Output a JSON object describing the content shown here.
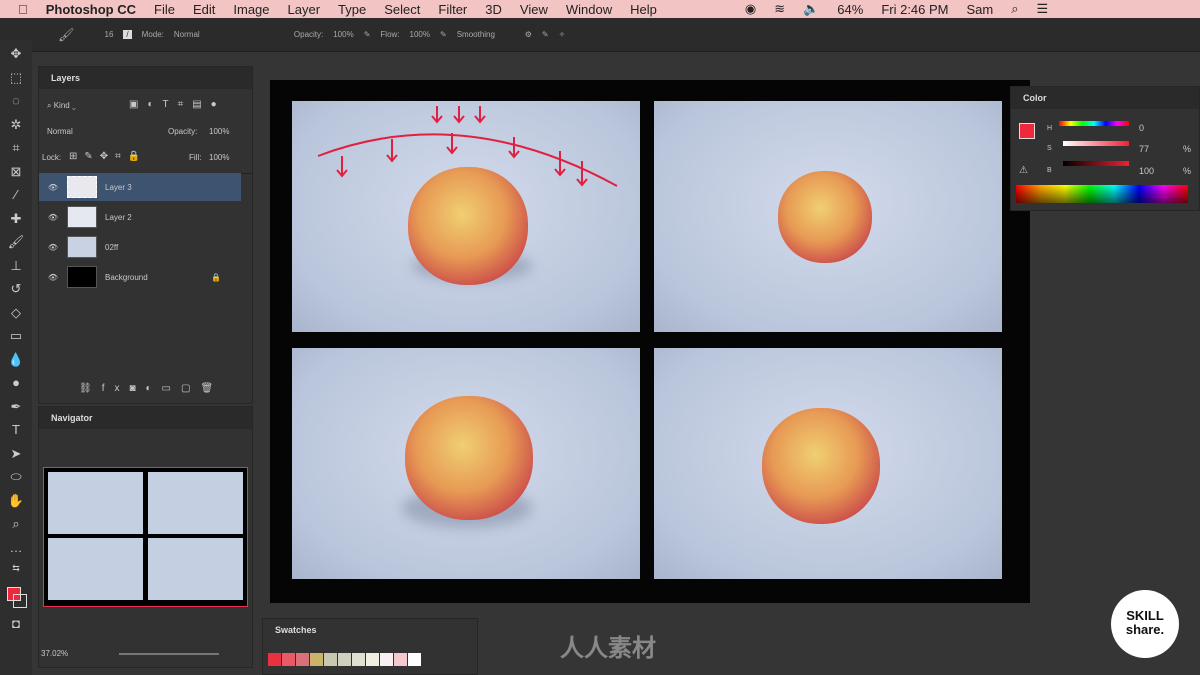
{
  "menubar": {
    "app": "Photoshop CC",
    "items": [
      "File",
      "Edit",
      "Image",
      "Layer",
      "Type",
      "Select",
      "Filter",
      "3D",
      "View",
      "Window",
      "Help"
    ],
    "battery": "64%",
    "clock": "Fri 2:46 PM",
    "user": "Sam"
  },
  "options": {
    "brush_size": "16",
    "mode_label": "Mode:",
    "mode": "Normal",
    "opacity_label": "Opacity:",
    "opacity": "100%",
    "flow_label": "Flow:",
    "flow": "100%",
    "smoothing_label": "Smoothing"
  },
  "layers": {
    "title": "Layers",
    "filter": "Kind",
    "blend": "Normal",
    "opacity_label": "Opacity:",
    "opacity": "100%",
    "lock_label": "Lock:",
    "fill_label": "Fill:",
    "fill": "100%",
    "items": [
      {
        "name": "Layer 3"
      },
      {
        "name": "Layer 2"
      },
      {
        "name": "02ff"
      },
      {
        "name": "Background"
      }
    ]
  },
  "navigator": {
    "title": "Navigator",
    "zoom": "37.02%"
  },
  "color": {
    "title": "Color",
    "h_label": "H",
    "h": "0",
    "s_label": "S",
    "s": "77",
    "b_label": "B",
    "b": "100",
    "pct": "%",
    "foreground": "#f0283c"
  },
  "swatches": {
    "title": "Swatches",
    "colors": [
      "#e8333f",
      "#e85a66",
      "#d9707a",
      "#c9b46a",
      "#c8c8b0",
      "#d0d0c0",
      "#e0e0d0",
      "#f0f0e0",
      "#f6f0f0",
      "#f4c8cc",
      "#ffffff"
    ]
  },
  "watermark": "人人素材",
  "badge": {
    "line1": "SKILL",
    "line2": "share."
  }
}
